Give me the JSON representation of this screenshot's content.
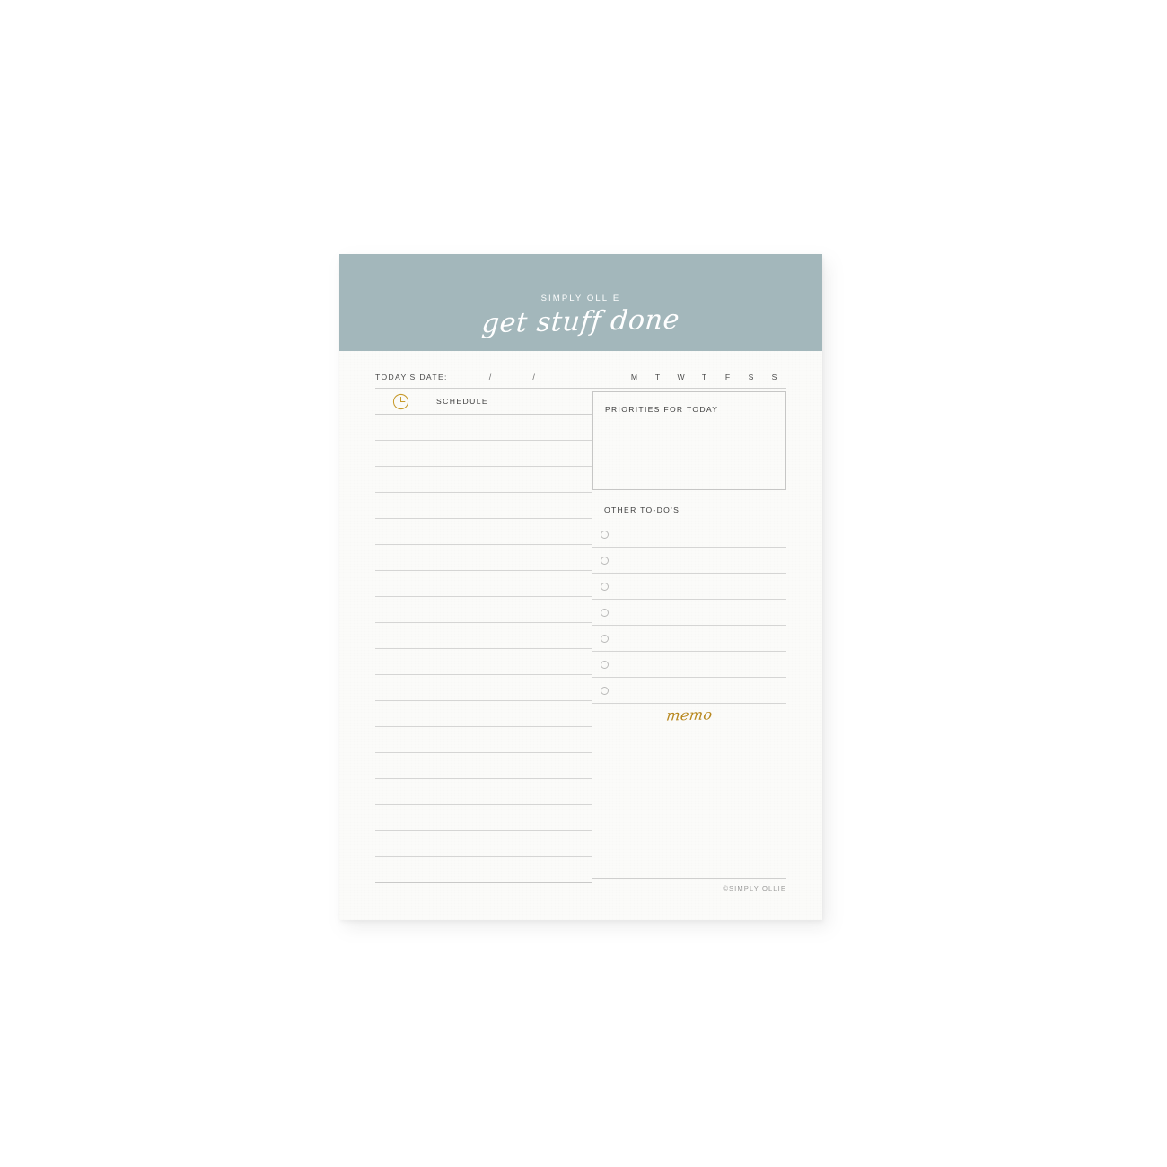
{
  "brand": {
    "name": "SIMPLY OLLIE",
    "tagline": "get stuff done",
    "credit": "©SIMPLY OLLIE"
  },
  "colors": {
    "header_band": "#a3b7bb",
    "paper": "#fbfbf9",
    "accent_gold": "#b8881f",
    "rule": "#d5d5d4",
    "text": "#3e3e3e"
  },
  "date_row": {
    "label": "TODAY'S DATE:",
    "slash_1": "/",
    "slash_2": "/",
    "weekdays": [
      "M",
      "T",
      "W",
      "T",
      "F",
      "S",
      "S"
    ]
  },
  "schedule": {
    "icon": "clock-icon",
    "title": "SCHEDULE",
    "rows": [
      "",
      "",
      "",
      "",
      "",
      "",
      "",
      "",
      "",
      "",
      "",
      "",
      "",
      "",
      "",
      "",
      "",
      ""
    ]
  },
  "priorities": {
    "title": "PRIORITIES FOR TODAY",
    "value": ""
  },
  "todos": {
    "title": "OTHER TO-DO'S",
    "items": [
      {
        "checked": false,
        "text": ""
      },
      {
        "checked": false,
        "text": ""
      },
      {
        "checked": false,
        "text": ""
      },
      {
        "checked": false,
        "text": ""
      },
      {
        "checked": false,
        "text": ""
      },
      {
        "checked": false,
        "text": ""
      },
      {
        "checked": false,
        "text": ""
      }
    ]
  },
  "memo": {
    "label": "memo",
    "value": ""
  }
}
